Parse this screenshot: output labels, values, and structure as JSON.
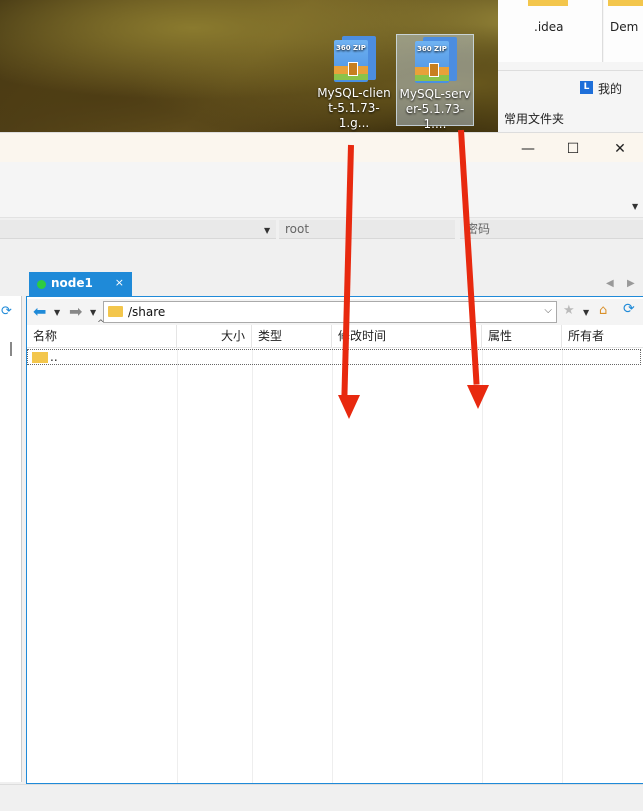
{
  "desktop": {
    "icons": [
      {
        "label_line1": "MySQL-clien",
        "label_line2": "t-5.1.73-1.g...",
        "badge": "360 ZIP"
      },
      {
        "label_line1": "MySQL-serv",
        "label_line2": "er-5.1.73-1....",
        "badge": "360 ZIP"
      }
    ],
    "explorer": {
      "tile1": ".idea",
      "tile2": "Dem",
      "wode": "我的",
      "changyong": "常用文件夹"
    }
  },
  "window": {
    "controls": {
      "minimize": "—",
      "maximize": "☐",
      "close": "✕"
    },
    "session": {
      "user_field": "root",
      "password_field": "密码"
    },
    "tab": {
      "label": "node1",
      "close": "×"
    },
    "address": {
      "path": "/share"
    },
    "columns": [
      "名称",
      "大小",
      "类型",
      "修改时间",
      "属性",
      "所有者"
    ],
    "rows": [
      {
        "name": ".."
      }
    ]
  },
  "colors": {
    "accent": "#1f8ad8",
    "arrow": "#e8290f",
    "folder": "#f3c64c"
  }
}
